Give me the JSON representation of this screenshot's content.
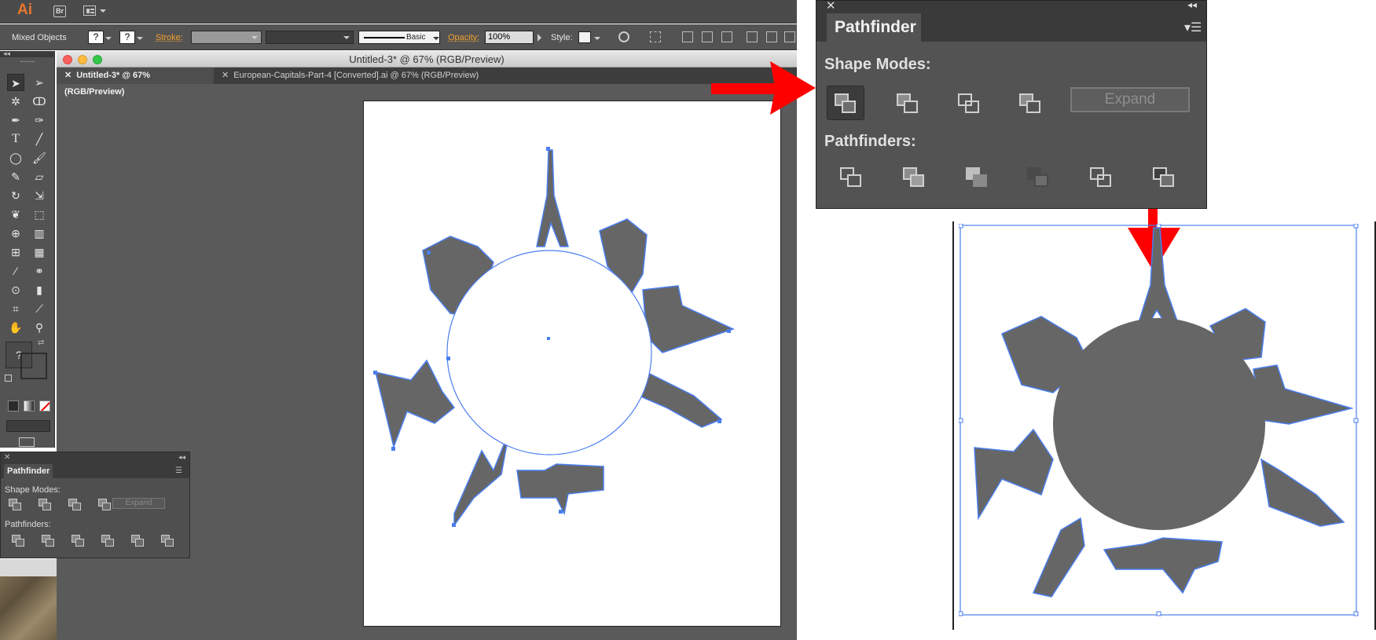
{
  "app": {
    "logo": "Ai",
    "bridge_label": "Br"
  },
  "control_bar": {
    "selection_type": "Mixed Objects",
    "fill_value": "?",
    "stroke_value": "?",
    "stroke_label": "Stroke:",
    "brush_label": "Basic",
    "opacity_label": "Opacity:",
    "opacity_value": "100%",
    "style_label": "Style:"
  },
  "document": {
    "window_title": "Untitled-3* @ 67% (RGB/Preview)",
    "tabs": [
      {
        "label": "Untitled-3* @ 67% (RGB/Preview)",
        "active": true
      },
      {
        "label": "European-Capitals-Part-4 [Converted].ai @ 67% (RGB/Preview)",
        "active": false
      }
    ]
  },
  "toolbar": {
    "fill_stroke_unknown": "?"
  },
  "pathfinder_small": {
    "title": "Pathfinder",
    "shape_modes_label": "Shape Modes:",
    "expand_label": "Expand",
    "pathfinders_label": "Pathfinders:"
  },
  "pathfinder_large": {
    "title": "Pathfinder",
    "shape_modes_label": "Shape Modes:",
    "expand_label": "Expand",
    "pathfinders_label": "Pathfinders:"
  },
  "colors": {
    "selection": "#4a7ef0",
    "artwork": "#666666",
    "arrow": "#ff0000"
  }
}
